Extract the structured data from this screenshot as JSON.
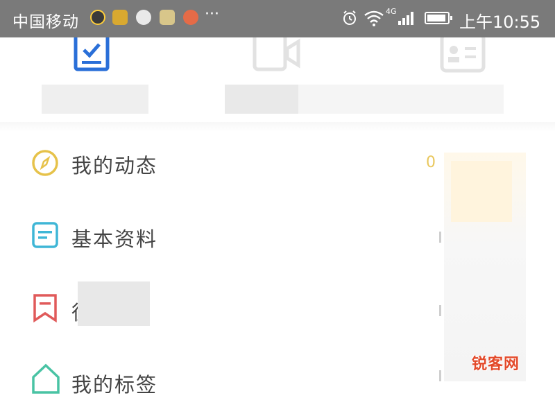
{
  "status_bar": {
    "carrier": "中国移动",
    "more": "···",
    "network": "4G",
    "time": "上午10:55",
    "icons": [
      "alarm-icon",
      "wifi-icon",
      "signal-icon",
      "battery-icon"
    ]
  },
  "menu": {
    "items": [
      {
        "label": "我的动态",
        "value": "0",
        "icon": "compass-icon",
        "color": "#e6c24a"
      },
      {
        "label": "基本资料",
        "icon": "profile-card-icon",
        "color": "#3fb6d6"
      },
      {
        "label": "徍",
        "icon": "bookmark-icon",
        "color": "#e05a5a"
      },
      {
        "label": "我的标签",
        "icon": "tag-icon",
        "color": "#49c3a4"
      }
    ]
  },
  "tabs": {
    "icons": [
      "checklist-icon",
      "video-camera-icon",
      "contact-card-icon"
    ],
    "active_color": "#2a6fd8",
    "inactive_color": "#e2e2e2"
  },
  "watermark": "锐客网"
}
